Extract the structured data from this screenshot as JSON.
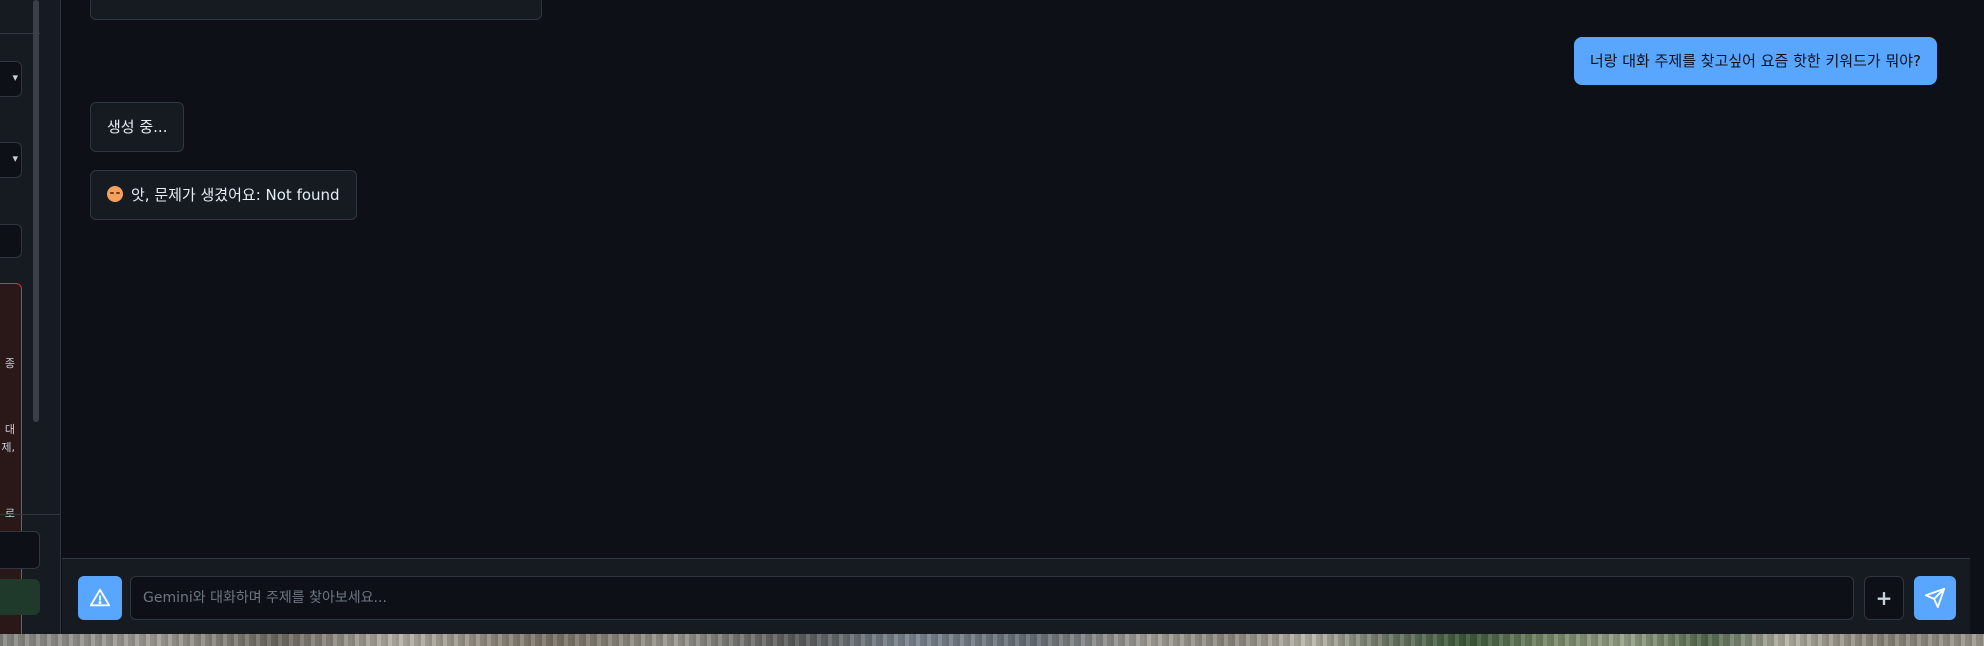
{
  "sidebar": {
    "warning_fragments": [
      "종",
      "대",
      "제,",
      "로"
    ]
  },
  "chat": {
    "messages": [
      {
        "role": "user",
        "text": "너랑 대화 주제를 찾고싶어 요즘 핫한 키워드가 뭐야?"
      },
      {
        "role": "assistant",
        "text": "생성 중..."
      },
      {
        "role": "assistant",
        "icon": "downcast-face-emoji",
        "text": "앗, 문제가 생겼어요: Not found"
      }
    ]
  },
  "composer": {
    "placeholder": "Gemini와 대화하며 주제를 찾아보세요...",
    "value": "",
    "warning_icon": "warning-triangle-icon",
    "attach_label": "+",
    "send_icon": "paper-plane-icon"
  },
  "colors": {
    "background": "#0d1117",
    "panel": "#161b22",
    "border": "#30363d",
    "accent": "#58a6ff",
    "warning_border": "#b1463c"
  }
}
